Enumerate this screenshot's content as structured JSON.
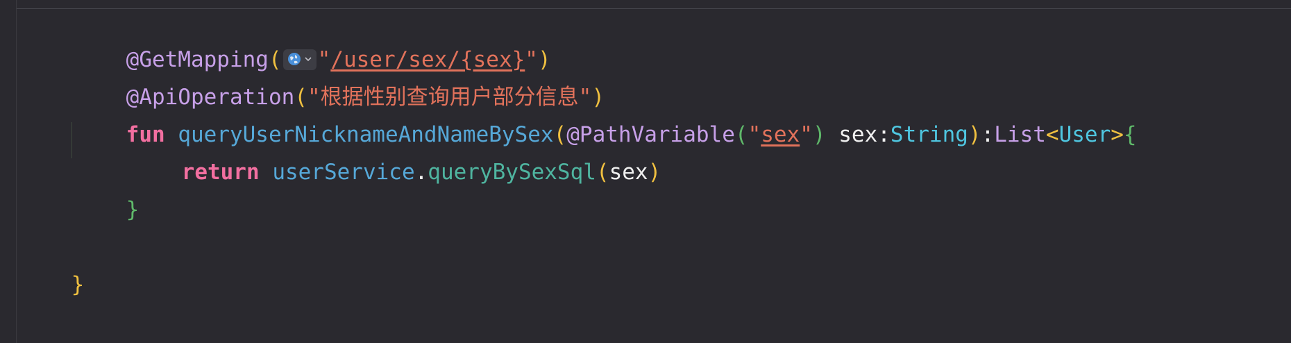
{
  "code": {
    "line1": {
      "annotation": "@GetMapping",
      "open_paren": "(",
      "quote_open": "\"",
      "path": "/user/sex/{sex}",
      "quote_close": "\"",
      "close_paren": ")"
    },
    "line2": {
      "annotation": "@ApiOperation",
      "open_paren": "(",
      "quote_open": "\"",
      "text": "根据性别查询用户部分信息",
      "quote_close": "\"",
      "close_paren": ")"
    },
    "line3": {
      "keyword": "fun",
      "function_name": "queryUserNicknameAndNameBySex",
      "open_paren": "(",
      "param_annotation": "@PathVariable",
      "anno_open": "(",
      "quote_open": "\"",
      "param_value": "sex",
      "quote_close": "\"",
      "anno_close": ")",
      "param_name": "sex",
      "colon": ":",
      "param_type": "String",
      "close_paren": ")",
      "return_colon": ":",
      "return_type": "List",
      "generic_open": "<",
      "generic_type": "User",
      "generic_close": ">",
      "brace_open": "{"
    },
    "line4": {
      "keyword": "return",
      "receiver": "userService",
      "dot": ".",
      "method": "queryBySexSql",
      "open_paren": "(",
      "argument": "sex",
      "close_paren": ")"
    },
    "line5": {
      "brace_close": "}"
    },
    "line7": {
      "brace_close": "}"
    }
  },
  "inlay_hint": {
    "icon": "globe-icon",
    "dropdown_icon": "chevron-down-icon"
  },
  "colors": {
    "background": "#2a292f",
    "annotation": "#c7a0e8",
    "string": "#e2725b",
    "keyword": "#f26fa0",
    "function": "#56a8d8",
    "type": "#4fc6e0"
  }
}
